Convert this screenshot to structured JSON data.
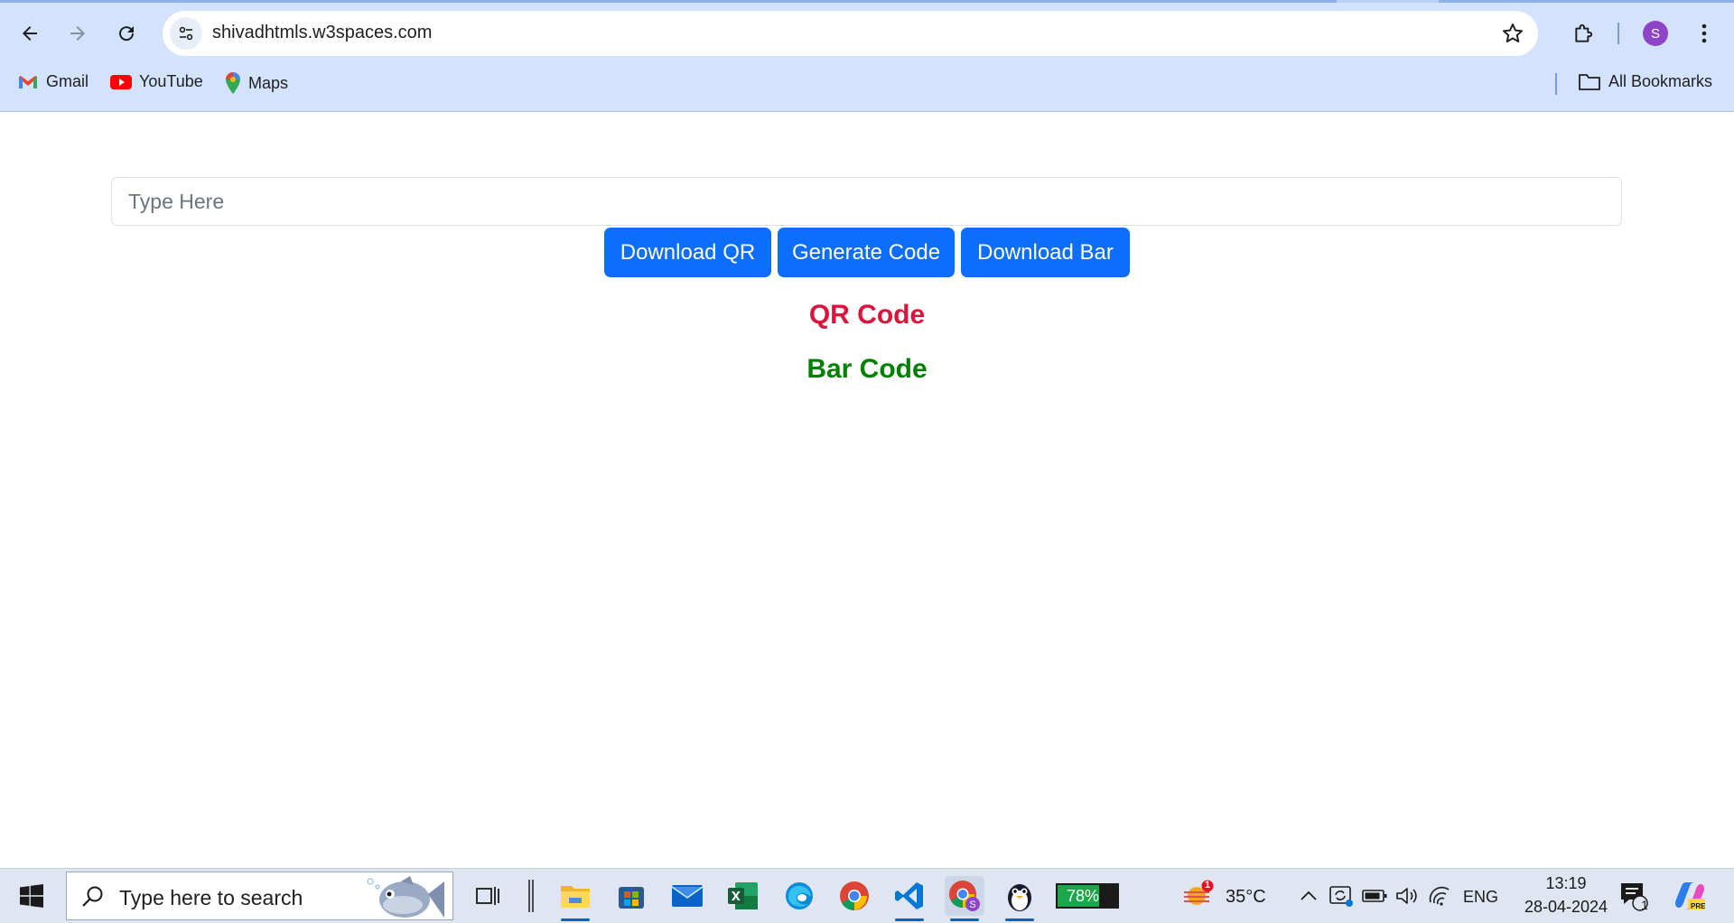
{
  "browser": {
    "url": "shivadhtmls.w3spaces.com",
    "profile_initial": "S",
    "bookmarks": [
      {
        "label": "Gmail",
        "icon": "gmail-icon"
      },
      {
        "label": "YouTube",
        "icon": "youtube-icon"
      },
      {
        "label": "Maps",
        "icon": "maps-icon"
      }
    ],
    "all_bookmarks_label": "All Bookmarks"
  },
  "page": {
    "input_placeholder": "Type Here",
    "buttons": {
      "download_qr": "Download QR",
      "generate_code": "Generate Code",
      "download_bar": "Download Bar"
    },
    "qr_heading": "QR Code",
    "bar_heading": "Bar Code",
    "colors": {
      "primary": "#0d6efd",
      "qr_heading": "#dc143c",
      "bar_heading": "#008000"
    }
  },
  "taskbar": {
    "search_placeholder": "Type here to search",
    "battery_widget": "78%",
    "weather_temp": "35°C",
    "weather_badge": "1",
    "language": "ENG",
    "time": "13:19",
    "date": "28-04-2024",
    "notification_count": "1",
    "copilot_badge": "PRE"
  }
}
